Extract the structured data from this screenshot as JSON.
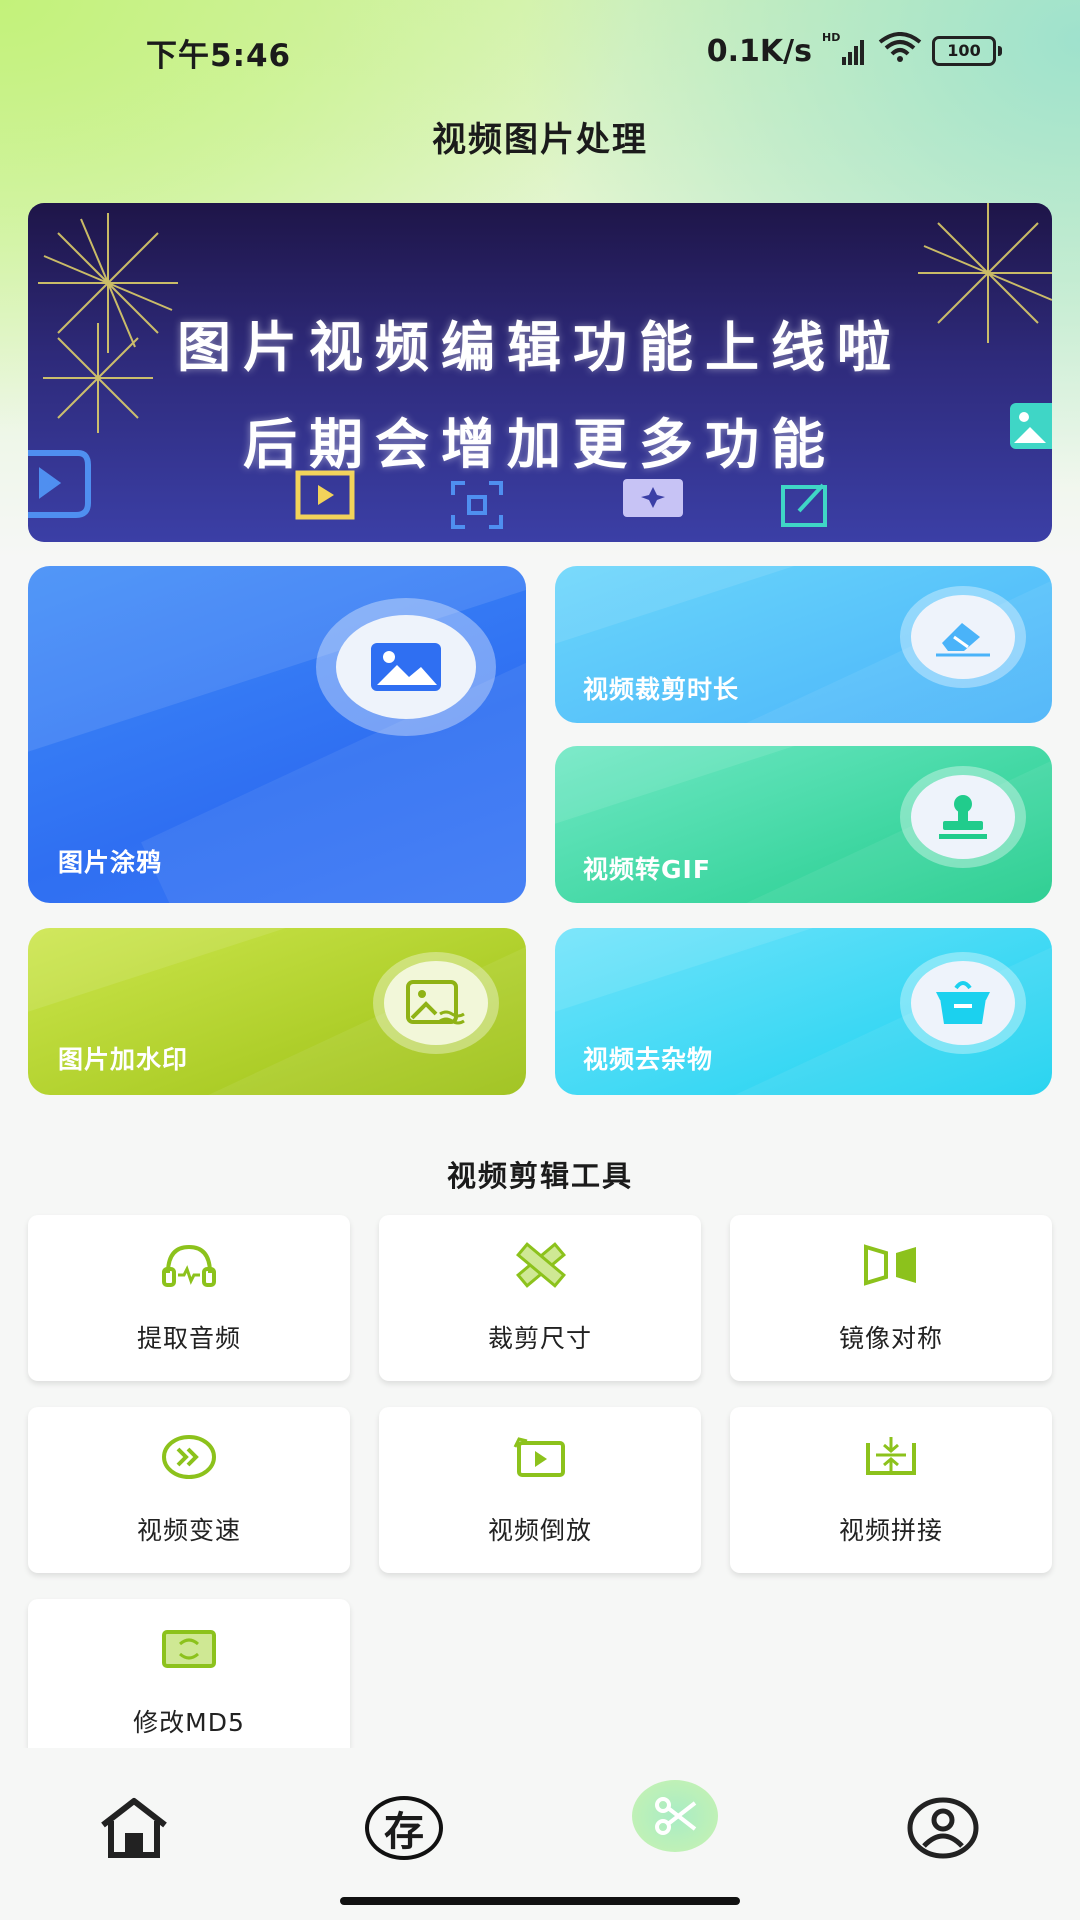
{
  "status_bar": {
    "time": "下午5:46",
    "network_speed": "0.1K/s",
    "signal_label": "HD",
    "battery": "100"
  },
  "page_title": "视频图片处理",
  "banner": {
    "line1": "图片视频编辑功能上线啦",
    "line2": "后期会增加更多功能"
  },
  "feature_cards": [
    {
      "label": "图片涂鸦",
      "icon": "image-icon"
    },
    {
      "label": "视频裁剪时长",
      "icon": "eraser-icon"
    },
    {
      "label": "视频转GIF",
      "icon": "stamp-icon"
    },
    {
      "label": "图片加水印",
      "icon": "image-wave-icon"
    },
    {
      "label": "视频去杂物",
      "icon": "box-icon"
    }
  ],
  "section_title": "视频剪辑工具",
  "tools": [
    {
      "label": "提取音频",
      "icon": "headphones-icon"
    },
    {
      "label": "裁剪尺寸",
      "icon": "ruler-pencil-icon"
    },
    {
      "label": "镜像对称",
      "icon": "mirror-icon"
    },
    {
      "label": "视频变速",
      "icon": "fast-forward-icon"
    },
    {
      "label": "视频倒放",
      "icon": "reverse-play-icon"
    },
    {
      "label": "视频拼接",
      "icon": "merge-icon"
    },
    {
      "label": "修改MD5",
      "icon": "refresh-icon"
    }
  ],
  "bottom_nav": [
    {
      "name": "home",
      "icon": "home-icon",
      "glyph": ""
    },
    {
      "name": "store",
      "icon": "cun-icon",
      "glyph": "存"
    },
    {
      "name": "edit",
      "icon": "scissors-icon",
      "glyph": ""
    },
    {
      "name": "profile",
      "icon": "user-icon",
      "glyph": ""
    }
  ],
  "colors": {
    "tool_icon": "#8cc21c",
    "banner_bg": "#2e2a7a",
    "nav_active_bg": "#b7efc0"
  }
}
